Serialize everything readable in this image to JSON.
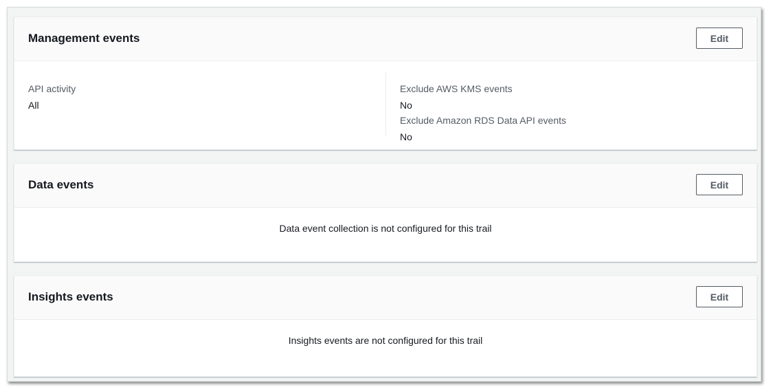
{
  "management": {
    "title": "Management events",
    "edit_label": "Edit",
    "api_activity_label": "API activity",
    "api_activity_value": "All",
    "exclude_kms_label": "Exclude AWS KMS events",
    "exclude_kms_value": "No",
    "exclude_rds_label": "Exclude Amazon RDS Data API events",
    "exclude_rds_value": "No"
  },
  "data_events": {
    "title": "Data events",
    "edit_label": "Edit",
    "message": "Data event collection is not configured for this trail"
  },
  "insights": {
    "title": "Insights events",
    "edit_label": "Edit",
    "message": "Insights events are not configured for this trail"
  }
}
